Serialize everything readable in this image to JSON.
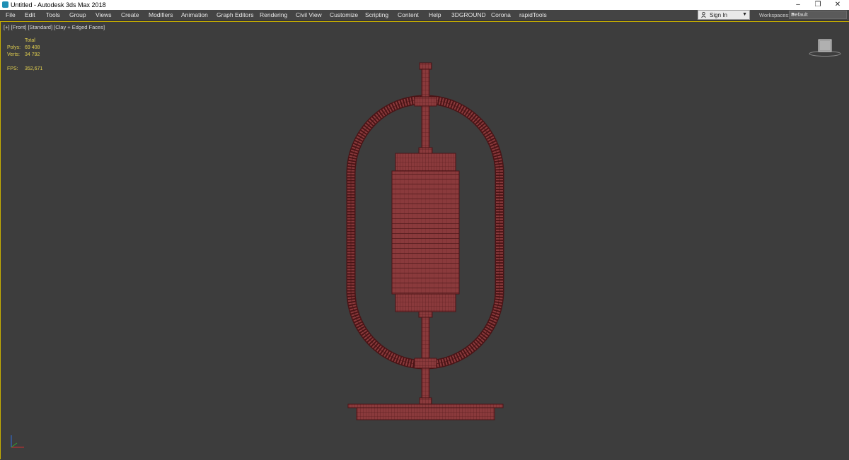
{
  "window": {
    "title": "Untitled - Autodesk 3ds Max 2018",
    "controls": {
      "minimize": "–",
      "restore": "❐",
      "close": "✕"
    }
  },
  "menu": {
    "items": [
      "File",
      "Edit",
      "Tools",
      "Group",
      "Views",
      "Create",
      "Modifiers",
      "Animation",
      "Graph Editors",
      "Rendering",
      "Civil View",
      "Customize",
      "Scripting",
      "Content",
      "Help",
      "3DGROUND",
      "Corona",
      "rapidTools"
    ]
  },
  "account": {
    "sign_in_label": "Sign In",
    "dropdown_glyph": "▼"
  },
  "workspaces": {
    "label": "Workspaces:",
    "selected": "Default",
    "dropdown_glyph": "▼"
  },
  "viewport": {
    "label_plus": "[+]",
    "label_view": "[Front]",
    "label_shading_mode": "[Standard]",
    "label_style": "[Clay + Edged Faces]",
    "stats": {
      "total_header": "Total",
      "polys_label": "Polys:",
      "polys_value": "69 408",
      "verts_label": "Verts:",
      "verts_value": "34 792",
      "fps_label": "FPS:",
      "fps_value": "352,671"
    },
    "colors": {
      "accent_border": "#c8b000",
      "model_fill": "#8a3a3c",
      "model_edge": "#4a1416",
      "stats_text": "#e3d04f",
      "background": "#3d3d3d"
    },
    "viewcube_icon": "view-cube",
    "axis_icon": "axis-tripod"
  }
}
